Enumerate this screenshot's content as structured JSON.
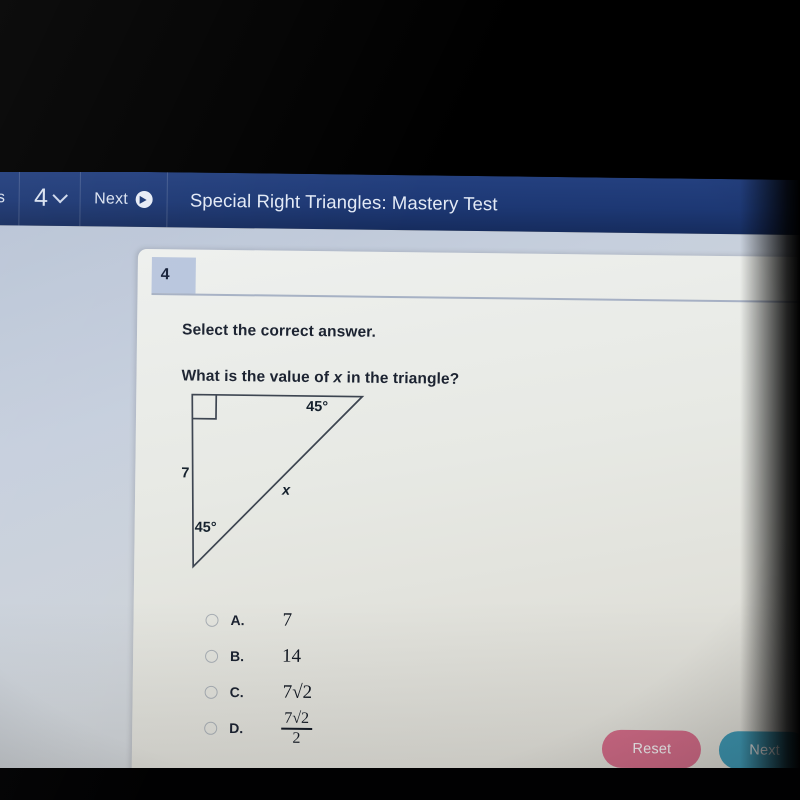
{
  "navbar": {
    "previous_label": "evious",
    "question_number": "4",
    "next_label": "Next",
    "next_icon": "arrow-right-circle-icon",
    "dropdown_icon": "chevron-down-icon",
    "title": "Special Right Triangles: Mastery Test",
    "background_color": "#1d3874"
  },
  "card": {
    "tab_number": "4",
    "instruction": "Select the correct answer.",
    "question_prefix": "What is the value of ",
    "question_variable": "x",
    "question_suffix": " in the triangle?"
  },
  "figure": {
    "type": "right-triangle",
    "side_label": "7",
    "angle_top_right": "45°",
    "angle_bottom_left": "45°",
    "hypotenuse_label": "x",
    "right_angle_marker": "square",
    "stroke_color": "#3c4450"
  },
  "options": [
    {
      "letter": "A.",
      "value": "7",
      "kind": "plain",
      "selected": false
    },
    {
      "letter": "B.",
      "value": "14",
      "kind": "plain",
      "selected": false
    },
    {
      "letter": "C.",
      "value": "7√2",
      "kind": "radical",
      "selected": false
    },
    {
      "letter": "D.",
      "numerator": "7√2",
      "denominator": "2",
      "kind": "fraction",
      "selected": false
    }
  ],
  "footer": {
    "reset_label": "Reset",
    "reset_color": "#cf6a85",
    "next_label": "Next",
    "next_color": "#3e96b0"
  }
}
